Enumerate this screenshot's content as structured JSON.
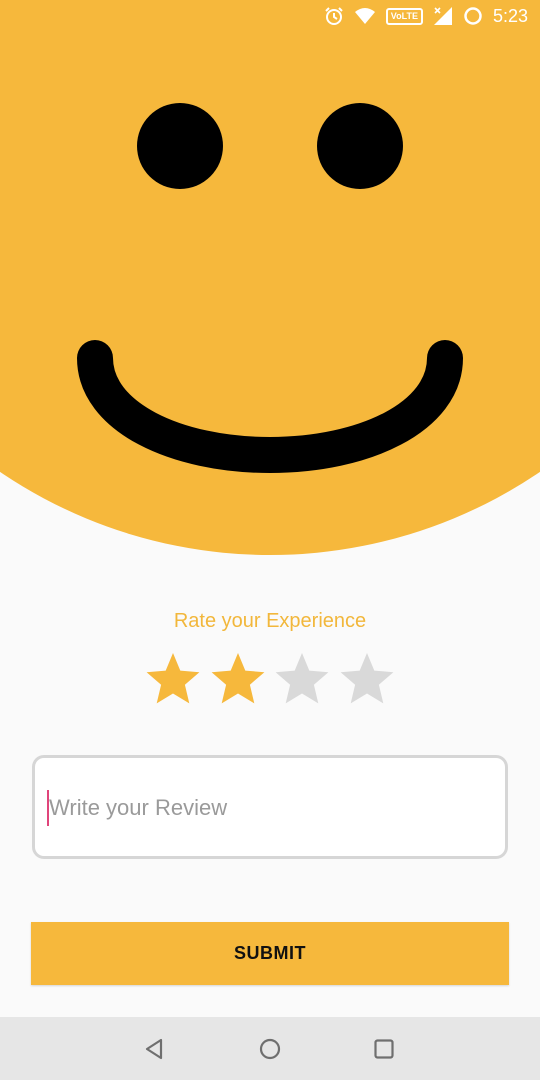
{
  "status_bar": {
    "time": "5:23",
    "network_badge": "VoLTE",
    "icons": [
      "alarm-icon",
      "wifi-icon",
      "volte-icon",
      "signal-icon",
      "battery-icon"
    ]
  },
  "hero": {
    "face_color": "#f6b83c",
    "expression": "smile"
  },
  "rating": {
    "title": "Rate your Experience",
    "max_stars": 4,
    "value": 2,
    "active_color": "#f6b83c",
    "inactive_color": "#d9d9d9"
  },
  "review": {
    "placeholder": "Write your Review",
    "value": ""
  },
  "submit": {
    "label": "SUBMIT",
    "color": "#f6b83c"
  },
  "nav_bar": {
    "icons": [
      "back-icon",
      "home-icon",
      "recents-icon"
    ]
  }
}
